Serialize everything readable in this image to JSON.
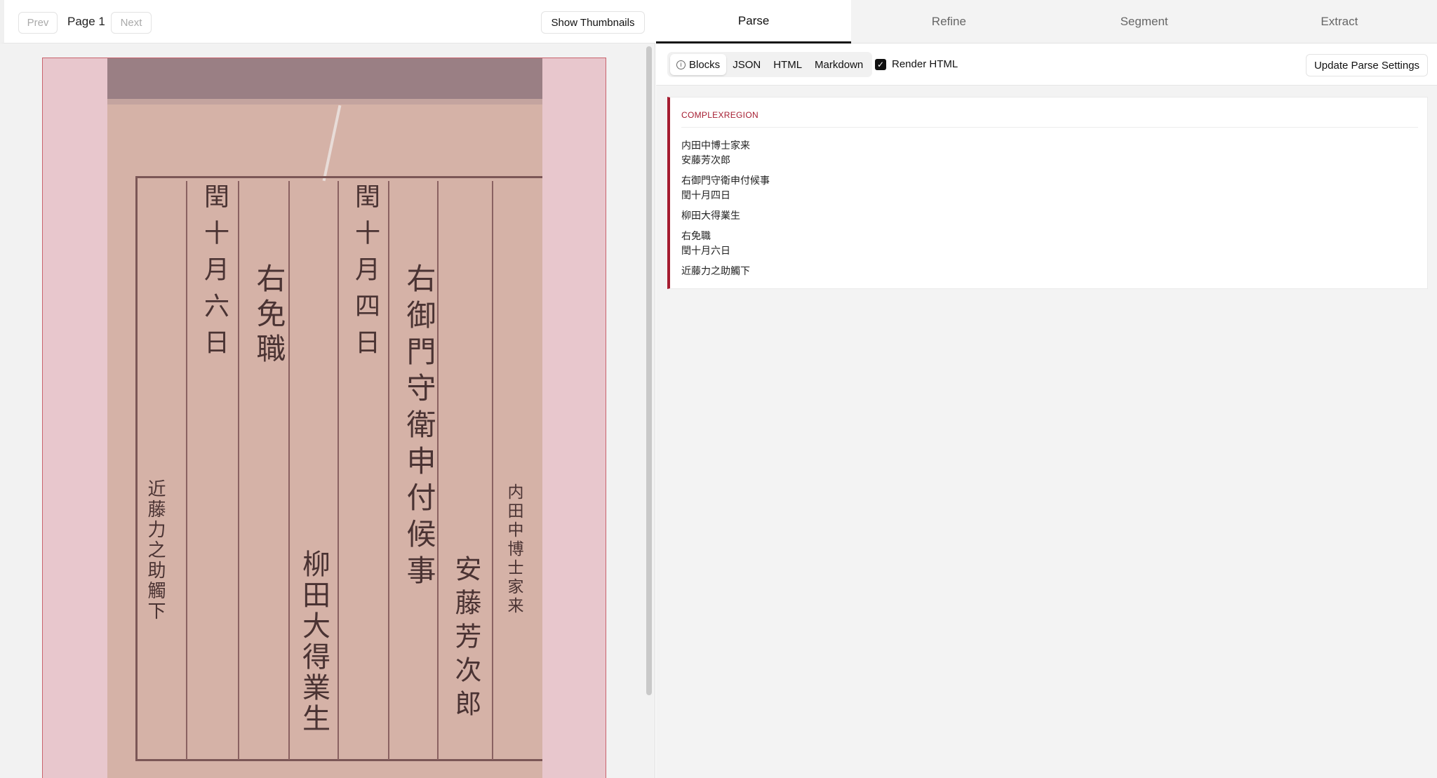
{
  "viewer": {
    "prev_label": "Prev",
    "page_label": "Page 1",
    "next_label": "Next",
    "thumbnails_label": "Show Thumbnails"
  },
  "document": {
    "columns": [
      "内田中博士家来",
      "安藤芳次郎",
      "右御門守衛申付候事",
      "閏十月四日",
      "柳田大得業生",
      "右免職",
      "閏十月六日",
      "近藤力之助觸下"
    ]
  },
  "tabs": [
    "Parse",
    "Refine",
    "Segment",
    "Extract"
  ],
  "active_tab": "Parse",
  "parse_toolbar": {
    "views": [
      "Blocks",
      "JSON",
      "HTML",
      "Markdown"
    ],
    "active_view": "Blocks",
    "render_html_label": "Render HTML",
    "render_html_checked": true,
    "update_label": "Update Parse Settings"
  },
  "block": {
    "type": "COMPLEXREGION",
    "accent_color": "#a51c30",
    "lines": [
      [
        "内田中博士家来",
        "安藤芳次郎"
      ],
      [
        "右御門守衛申付候事",
        "閏十月四日"
      ],
      [
        "柳田大得業生"
      ],
      [
        "右免職",
        "閏十月六日"
      ],
      [
        "近藤力之助觸下"
      ]
    ]
  }
}
